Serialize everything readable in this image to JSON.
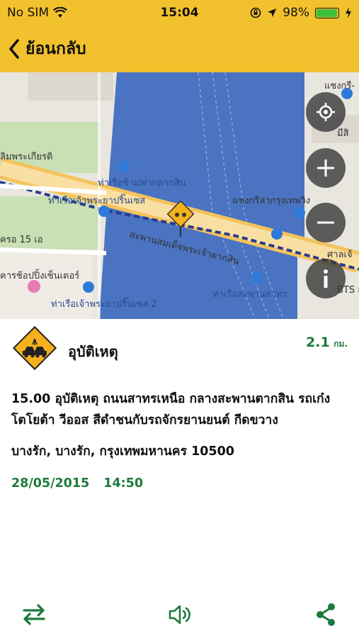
{
  "status": {
    "carrier": "No SIM",
    "time": "15:04",
    "battery": "98%",
    "battery_level": 0.98
  },
  "nav": {
    "back_label": "ย้อนกลับ",
    "accent": "#f2c12e"
  },
  "map": {
    "labels": {
      "park": "ลิมพระเกียรติ",
      "pier_opposite": "ท่าเรือข้ามฟากตากสิน",
      "pier_princess": "ท่าเรือเจ้าพระยาปริ๊นเซส",
      "bridge": "สะพานสมเด็จพระเจ้าตากสิน",
      "shangrila": "แชงกรีล่ากรุงเทพวิง",
      "shopping": "คารช้อปปิ้งเซ็นเตอร์",
      "pier_princess2": "ท่าเรือเจ้าพระยาปริ๊นเซส 2",
      "pier_sathorn": "ท่าเรือสะพานสาทร",
      "soi15": "ครอ 15 เอ",
      "shangri_top": "แชงกรี-",
      "misi": "มีสิ",
      "sala": "ศาลเจ้",
      "bts": "BTS สะพ"
    },
    "buttons": {
      "locate": "locate-icon",
      "zoom_in": "zoom-in-icon",
      "zoom_out": "zoom-out-icon",
      "info": "info-icon"
    }
  },
  "incident": {
    "title": "อุบัติเหตุ",
    "distance_value": "2.1",
    "distance_unit": "กม.",
    "description": "15.00 อุบัติเหตุ ถนนสาทรเหนือ กลางสะพานตากสิน รถเก๋งโตโยต้า วีออส สีดำชนกับรถจักรยานยนต์ กีดขวาง",
    "address": "บางรัก, บางรัก, กรุงเทพมหานคร 10500",
    "date": "28/05/2015",
    "time": "14:50",
    "accent": "#1e7a3b"
  },
  "toolbar": {
    "route": "route-swap-icon",
    "sound": "speaker-icon",
    "share": "share-icon"
  }
}
